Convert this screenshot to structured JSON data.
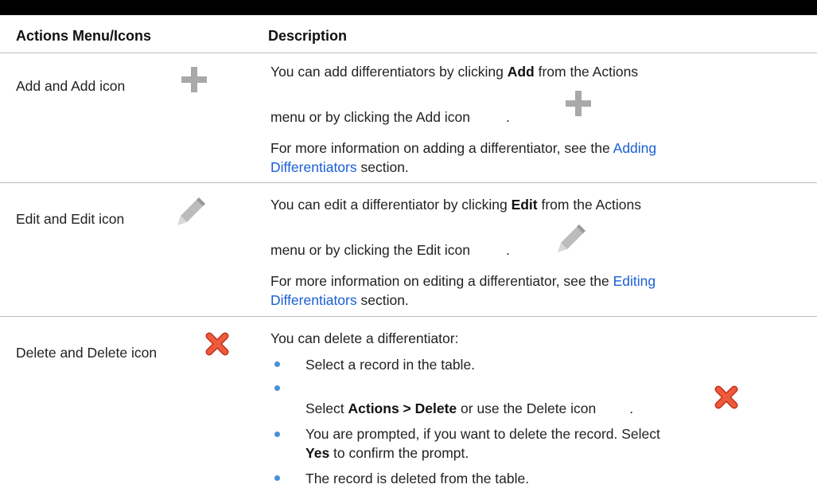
{
  "table": {
    "headers": {
      "col1": "Actions Menu/Icons",
      "col2": "Description"
    },
    "rows": [
      {
        "action_label": "Add and Add icon",
        "icon": "add-icon",
        "desc_line1_pre": "You can add differentiators by clicking ",
        "desc_line1_bold": "Add",
        "desc_line1_post": " from the Actions",
        "desc_line2_pre": "menu or by clicking the Add icon",
        "desc_line2_post": ".",
        "info_pre": "For more information on adding a differentiator, see the ",
        "link_part1": "Adding",
        "link_part2": "Differentiators",
        "info_post": " section."
      },
      {
        "action_label": "Edit and Edit icon",
        "icon": "pencil-icon",
        "desc_line1_pre": "You can edit a differentiator by clicking ",
        "desc_line1_bold": "Edit",
        "desc_line1_post": " from the Actions",
        "desc_line2_pre": "menu or by clicking the Edit icon",
        "desc_line2_post": ".",
        "info_pre": "For more information on editing a differentiator, see the ",
        "link_part1": "Editing",
        "link_part2": "Differentiators",
        "info_post": " section."
      },
      {
        "action_label": "Delete and Delete icon",
        "icon": "delete-x-icon",
        "intro": "You can delete a differentiator:",
        "bullet1": "Select a record in the table.",
        "bullet2_pre": "Select ",
        "bullet2_bold": "Actions > Delete",
        "bullet2_mid": " or use the Delete icon",
        "bullet2_post": ".",
        "bullet3_line1": "You are prompted, if you want to delete the record. Select",
        "bullet3_bold": "Yes",
        "bullet3_line2_post": " to confirm the prompt.",
        "bullet4": "The record is deleted from the table."
      }
    ]
  },
  "colors": {
    "link": "#1a5ed6",
    "bullet": "#4a90d9",
    "delete_icon": "#e8412a",
    "icon_gray": "#a9a9a9"
  }
}
